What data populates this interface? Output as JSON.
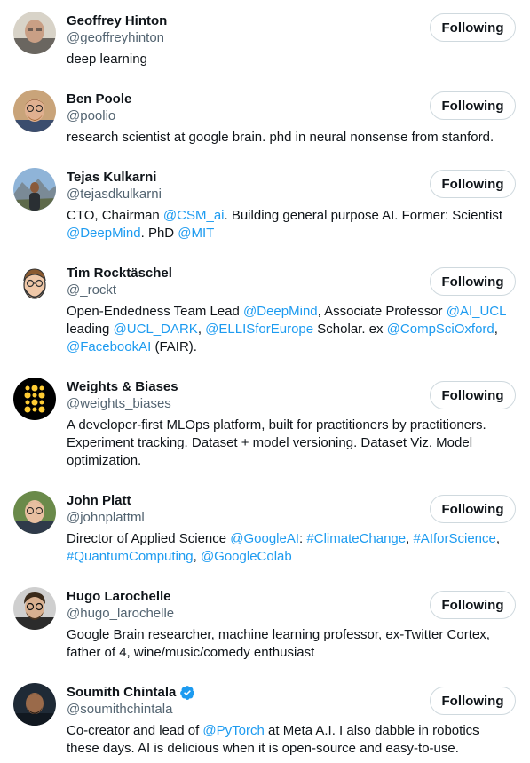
{
  "follow_button_label": "Following",
  "colors": {
    "mention": "#1d9bf0",
    "secondary_text": "#536471",
    "verified": "#1d9bf0"
  },
  "users": [
    {
      "name": "Geoffrey Hinton",
      "handle": "@geoffreyhinton",
      "verified": false,
      "avatar": "portrait-photo",
      "bio": [
        {
          "t": "deep learning"
        }
      ]
    },
    {
      "name": "Ben Poole",
      "handle": "@poolio",
      "verified": false,
      "avatar": "portrait-photo",
      "bio": [
        {
          "t": "research scientist at google brain. phd in neural nonsense from stanford."
        }
      ]
    },
    {
      "name": "Tejas Kulkarni",
      "handle": "@tejasdkulkarni",
      "verified": false,
      "avatar": "mountain-photo",
      "bio": [
        {
          "t": "CTO, Chairman "
        },
        {
          "t": "@CSM_ai",
          "link": true
        },
        {
          "t": ". Building general purpose AI. Former: Scientist "
        },
        {
          "t": "@DeepMind",
          "link": true
        },
        {
          "t": ". PhD "
        },
        {
          "t": "@MIT",
          "link": true
        }
      ]
    },
    {
      "name": "Tim Rocktäschel",
      "handle": "@_rockt",
      "verified": false,
      "avatar": "cartoon-portrait",
      "bio": [
        {
          "t": "Open-Endedness Team Lead "
        },
        {
          "t": "@DeepMind",
          "link": true
        },
        {
          "t": ", Associate Professor "
        },
        {
          "t": "@AI_UCL",
          "link": true
        },
        {
          "t": " leading "
        },
        {
          "t": "@UCL_DARK",
          "link": true
        },
        {
          "t": ", "
        },
        {
          "t": "@ELLISforEurope",
          "link": true
        },
        {
          "t": " Scholar. ex "
        },
        {
          "t": "@CompSciOxford",
          "link": true
        },
        {
          "t": ", "
        },
        {
          "t": "@FacebookAI",
          "link": true
        },
        {
          "t": " (FAIR)."
        }
      ]
    },
    {
      "name": "Weights & Biases",
      "handle": "@weights_biases",
      "verified": false,
      "avatar": "dots-logo",
      "bio": [
        {
          "t": "A developer-first MLOps platform, built for practitioners by practitioners. Experiment tracking. Dataset + model versioning. Dataset Viz. Model optimization."
        }
      ]
    },
    {
      "name": "John Platt",
      "handle": "@johnplattml",
      "verified": false,
      "avatar": "portrait-photo",
      "bio": [
        {
          "t": "Director of Applied Science "
        },
        {
          "t": "@GoogleAI",
          "link": true
        },
        {
          "t": ": "
        },
        {
          "t": "#ClimateChange",
          "link": true
        },
        {
          "t": ", "
        },
        {
          "t": "#AIforScience",
          "link": true
        },
        {
          "t": ", "
        },
        {
          "t": "#QuantumComputing",
          "link": true
        },
        {
          "t": ", "
        },
        {
          "t": "@GoogleColab",
          "link": true
        }
      ]
    },
    {
      "name": "Hugo Larochelle",
      "handle": "@hugo_larochelle",
      "verified": false,
      "avatar": "portrait-photo",
      "bio": [
        {
          "t": "Google Brain researcher, machine learning professor, ex-Twitter Cortex, father of 4, wine/music/comedy enthusiast"
        }
      ]
    },
    {
      "name": "Soumith Chintala",
      "handle": "@soumithchintala",
      "verified": true,
      "avatar": "portrait-photo",
      "bio": [
        {
          "t": "Co-creator and lead of "
        },
        {
          "t": "@PyTorch",
          "link": true
        },
        {
          "t": " at Meta A.I. I also dabble in robotics these days. AI is delicious when it is open-source and easy-to-use."
        }
      ]
    }
  ]
}
